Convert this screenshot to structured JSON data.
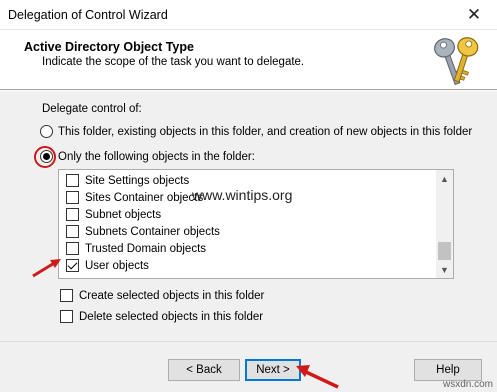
{
  "window": {
    "title": "Delegation of Control Wizard",
    "close_glyph": "✕"
  },
  "header": {
    "title": "Active Directory Object Type",
    "subtitle": "Indicate the scope of the task you want to delegate.",
    "icon": "keys-icon"
  },
  "body": {
    "delegate_label": "Delegate control of:",
    "radio_all": {
      "label": "This folder, existing objects in this folder, and creation of new objects in this folder",
      "selected": false
    },
    "radio_only": {
      "label": "Only the following objects in the folder:",
      "selected": true
    },
    "object_list": [
      {
        "label": "Site Settings objects",
        "checked": false
      },
      {
        "label": "Sites Container objects",
        "checked": false
      },
      {
        "label": "Subnet objects",
        "checked": false
      },
      {
        "label": "Subnets Container objects",
        "checked": false
      },
      {
        "label": "Trusted Domain objects",
        "checked": false
      },
      {
        "label": "User objects",
        "checked": true
      }
    ],
    "create_option": {
      "label": "Create selected objects in this folder",
      "checked": false
    },
    "delete_option": {
      "label": "Delete selected objects in this folder",
      "checked": false
    }
  },
  "watermark": "www.wintips.org",
  "footer": {
    "back_label": "< Back",
    "next_label": "Next >",
    "help_label": "Help"
  },
  "site_tag": "wsxdn.com",
  "colors": {
    "annotation_red": "#d01a1a",
    "accent_blue": "#0078d7"
  }
}
